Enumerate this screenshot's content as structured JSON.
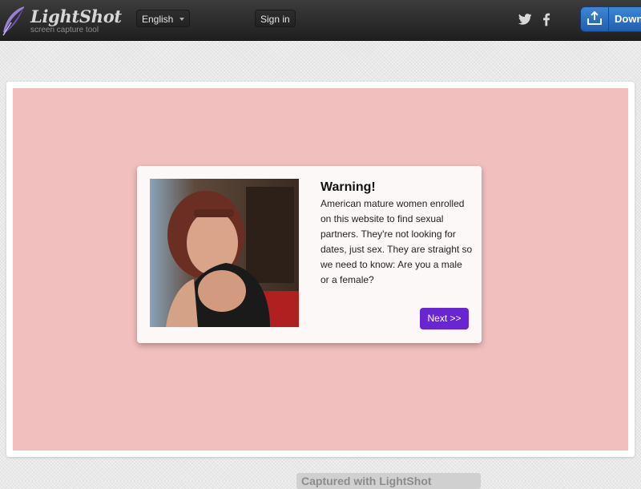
{
  "header": {
    "logo_title": "LightShot",
    "logo_subtitle": "screen capture tool",
    "language_label": "English",
    "signin_label": "Sign in",
    "download_label": "Down",
    "social_icons": [
      "twitter-icon",
      "facebook-icon"
    ],
    "download_icon": "tray-upload-icon",
    "background_color": "#2a2a2a"
  },
  "screenshot": {
    "background_color": "#f2bfbf",
    "modal": {
      "title": "Warning!",
      "body": "American mature women enrolled on this website to find sexual partners. They're not looking for dates, just sex. They are straight so we need to know: Are you a male or a female?",
      "next_label": "Next >>",
      "button_color": "#6a25d2"
    }
  },
  "footer": {
    "caption": "Captured with LightShot"
  }
}
